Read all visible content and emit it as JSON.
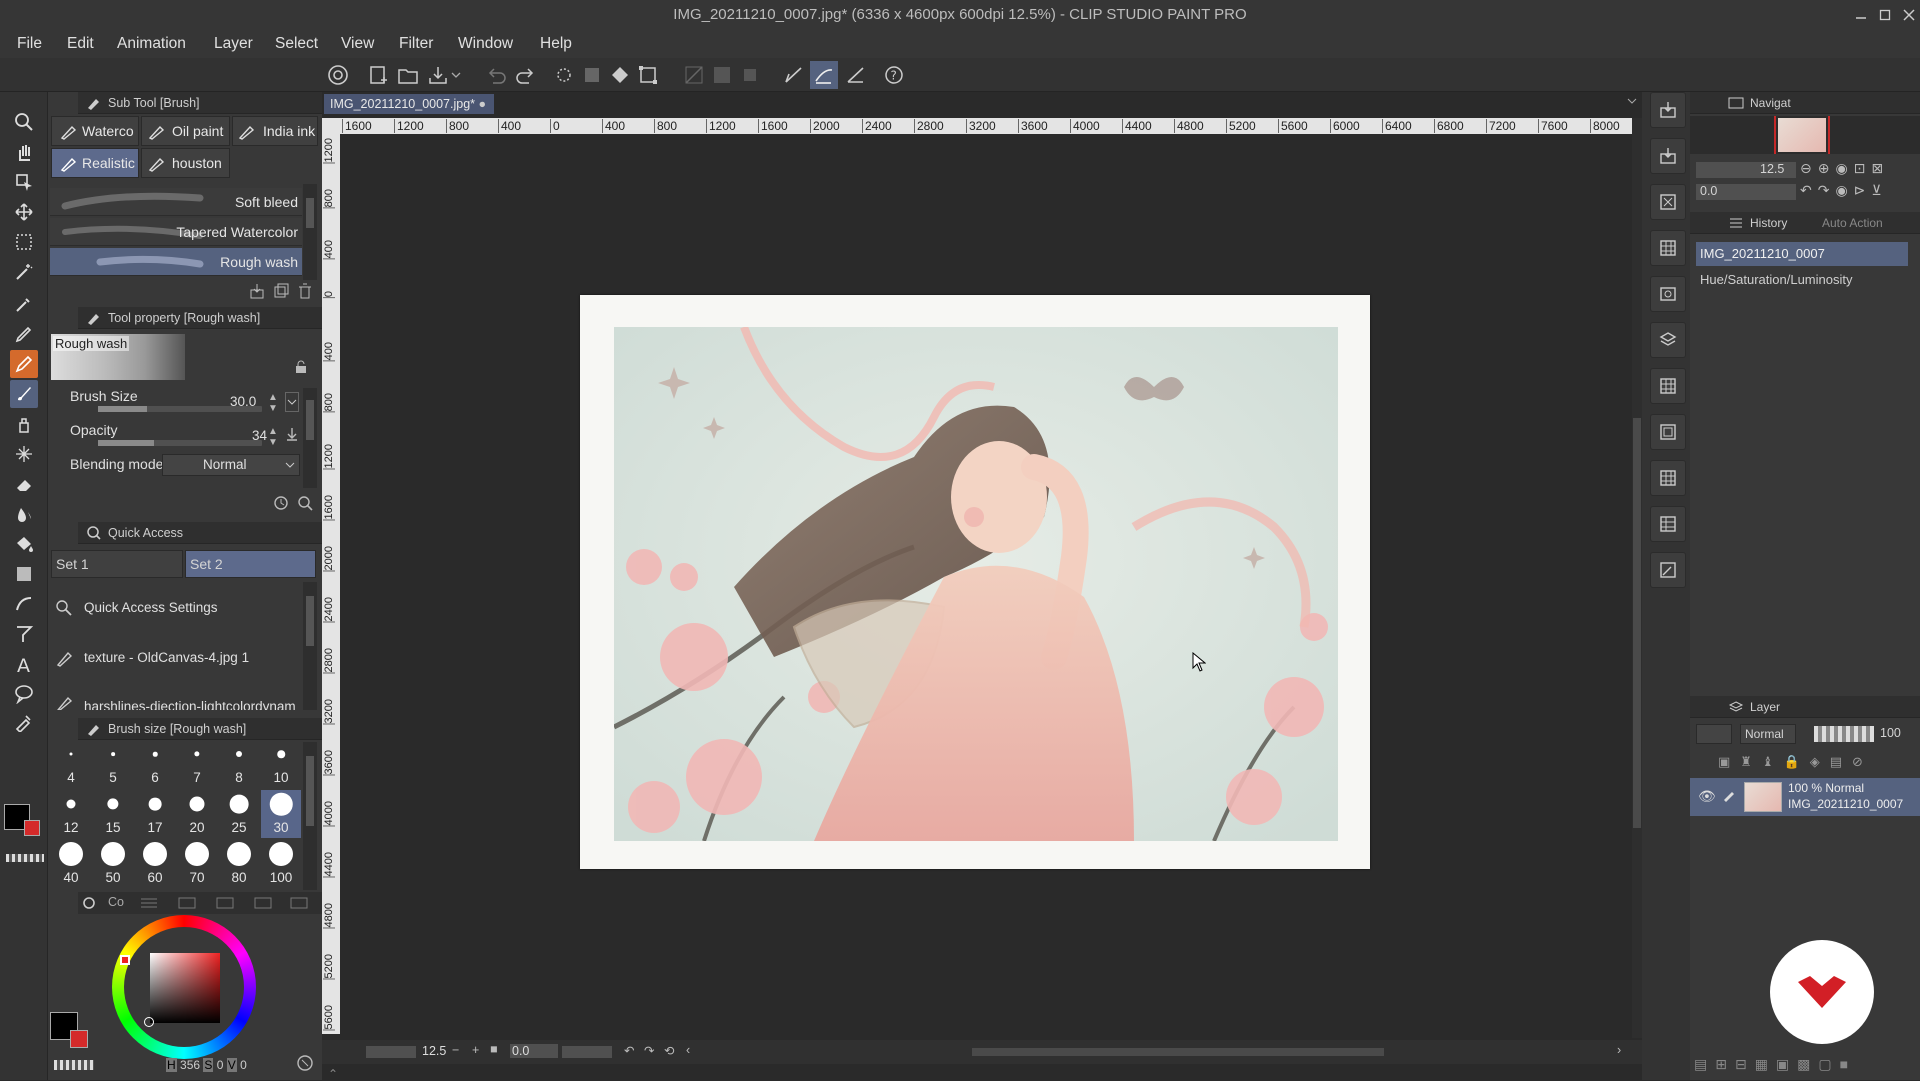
{
  "window": {
    "title": "IMG_20211210_0007.jpg* (6336 x 4600px 600dpi 12.5%) - CLIP STUDIO PAINT PRO"
  },
  "menu": [
    "File",
    "Edit",
    "Animation",
    "Layer",
    "Select",
    "View",
    "Filter",
    "Window",
    "Help"
  ],
  "sub_tool": {
    "title": "Sub Tool [Brush]",
    "tabs": [
      "Waterco",
      "Oil paint",
      "India ink",
      "Realistic",
      "houston"
    ],
    "brushes": [
      "Soft bleed",
      "Tapered Watercolor",
      "Rough wash"
    ]
  },
  "tool_property": {
    "title": "Tool property [Rough wash]",
    "preview_label": "Rough wash",
    "brush_size_label": "Brush Size",
    "brush_size_value": "30.0",
    "brush_size_fraction": 0.3,
    "opacity_label": "Opacity",
    "opacity_value": "34",
    "opacity_fraction": 0.34,
    "blending_label": "Blending mode",
    "blending_value": "Normal"
  },
  "quick_access": {
    "title": "Quick Access",
    "sets": [
      "Set 1",
      "Set 2"
    ],
    "items": [
      "Quick Access Settings",
      "texture - OldCanvas-4.jpg 1",
      "harshlines-diection-lightcolordynam"
    ]
  },
  "brush_size_panel": {
    "title": "Brush size [Rough wash]",
    "sizes": [
      "4",
      "5",
      "6",
      "7",
      "8",
      "10",
      "12",
      "15",
      "17",
      "20",
      "25",
      "30",
      "40",
      "50",
      "60",
      "70",
      "80",
      "100"
    ],
    "selected": "30"
  },
  "color_panel": {
    "tab_label": "Co",
    "status_left": "356",
    "status_mid": "0",
    "status_right": "0",
    "main_color": "#000000",
    "sub_color": "#d42a2a"
  },
  "canvas": {
    "doc_tab": "IMG_20211210_0007.jpg*",
    "ruler_h": [
      "1600",
      "1200",
      "800",
      "400",
      "0",
      "400",
      "800",
      "1200",
      "1600",
      "2000",
      "2400",
      "2800",
      "3200",
      "3600",
      "4000",
      "4400",
      "4800",
      "5200",
      "5600",
      "6000",
      "6400",
      "6800",
      "7200",
      "7600",
      "8000"
    ],
    "ruler_v": [
      "1200",
      "800",
      "400",
      "0",
      "400",
      "800",
      "1200",
      "1600",
      "2000",
      "2400",
      "2800",
      "3200",
      "3600",
      "4000",
      "4400",
      "4800",
      "5200",
      "5600"
    ],
    "zoom": "12.5",
    "angle": "0.0"
  },
  "navigator": {
    "title": "Navigat",
    "zoom": "12.5",
    "angle": "0.0"
  },
  "history": {
    "title": "History",
    "auto_action": "Auto Action",
    "items": [
      "IMG_20211210_0007",
      "Hue/Saturation/Luminosity"
    ]
  },
  "layer": {
    "title": "Layer",
    "blend": "Normal",
    "opacity": "100",
    "layer_line1": "100 % Normal",
    "layer_line2": "IMG_20211210_0007"
  }
}
